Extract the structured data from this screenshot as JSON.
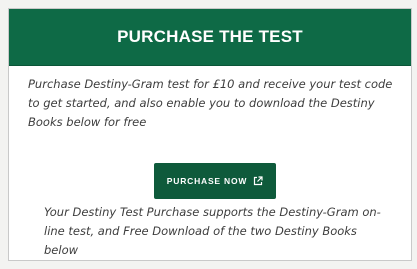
{
  "panel": {
    "title": "PURCHASE THE TEST",
    "intro_text": "Purchase Destiny-Gram test for £10 and receive your test code to get started, and also enable you to download the Destiny Books below for free",
    "purchase_button": {
      "label": "PURCHASE NOW",
      "icon": "external-link-icon"
    },
    "note_text": "Your Destiny Test Purchase supports the Destiny-Gram on-line test, and Free Download of the two Destiny Books below"
  },
  "colors": {
    "header_bg": "#0e6a46",
    "button_bg": "#0e5a3b",
    "text": "#3d3d3d"
  }
}
